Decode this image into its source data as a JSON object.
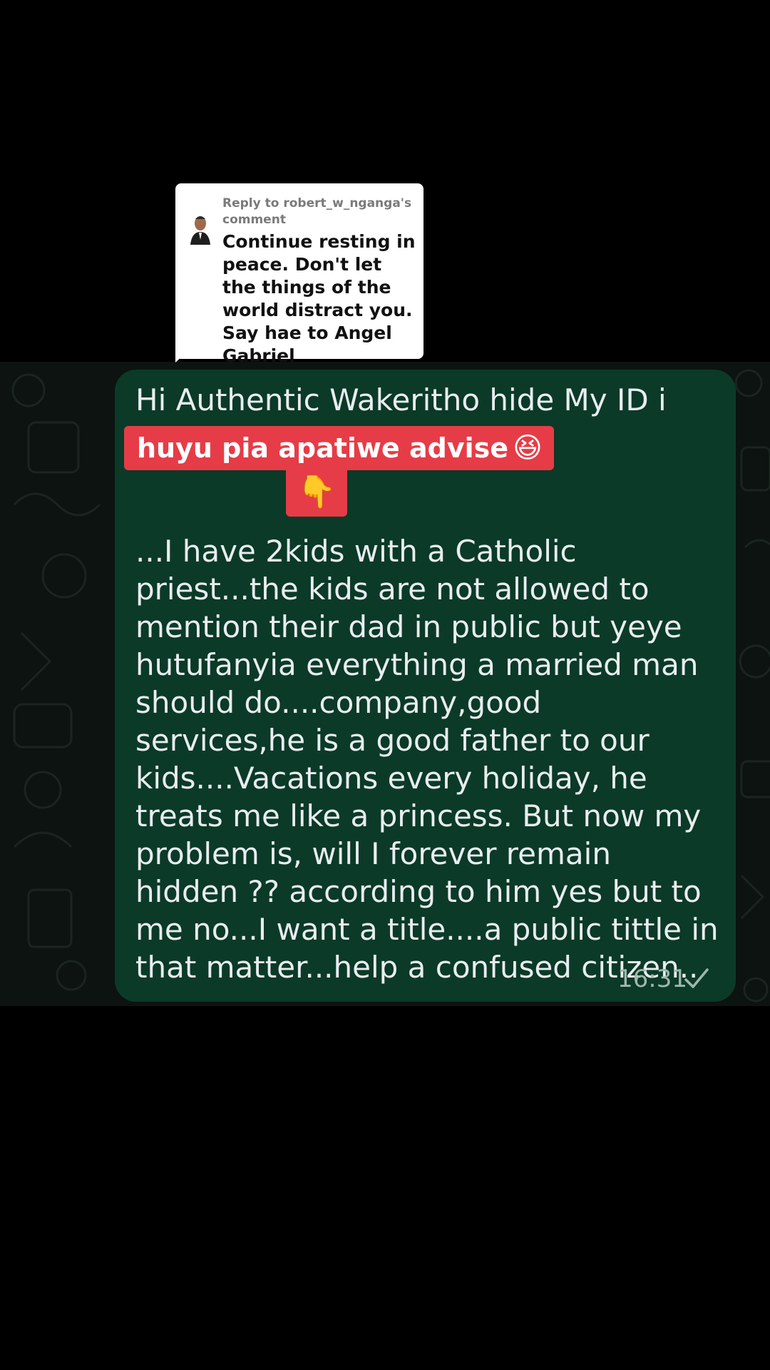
{
  "reply_card": {
    "header": "Reply to robert_w_nganga's comment",
    "text": "Continue resting in peace. Don't let the things of the world distract you. Say hae to Angel Gabriel",
    "avatar_icon": "user-avatar-icon"
  },
  "message": {
    "line1": "Hi Authentic Wakeritho hide My ID i",
    "body": "...I have 2kids with a Catholic priest...the kids are not allowed to mention their dad in public but yeye hutufanyia everything a married man should do....company,good services,he is a good father to our kids....Vacations every holiday, he treats me like a princess. But now my problem is, will I forever remain hidden ?? according to him yes but to me no...I want a title....a public tittle in that matter...help a confused citizen..",
    "timestamp": "16:31",
    "status_icon": "single-check-icon"
  },
  "overlay": {
    "caption": "huyu pia apatiwe advise",
    "caption_emoji": "😆",
    "pointer_emoji": "👇"
  },
  "colors": {
    "background": "#000000",
    "chat_wallpaper": "#0c1311",
    "bubble": "#0b3a28",
    "overlay_red": "#e63c47",
    "message_text": "#e9edef"
  }
}
